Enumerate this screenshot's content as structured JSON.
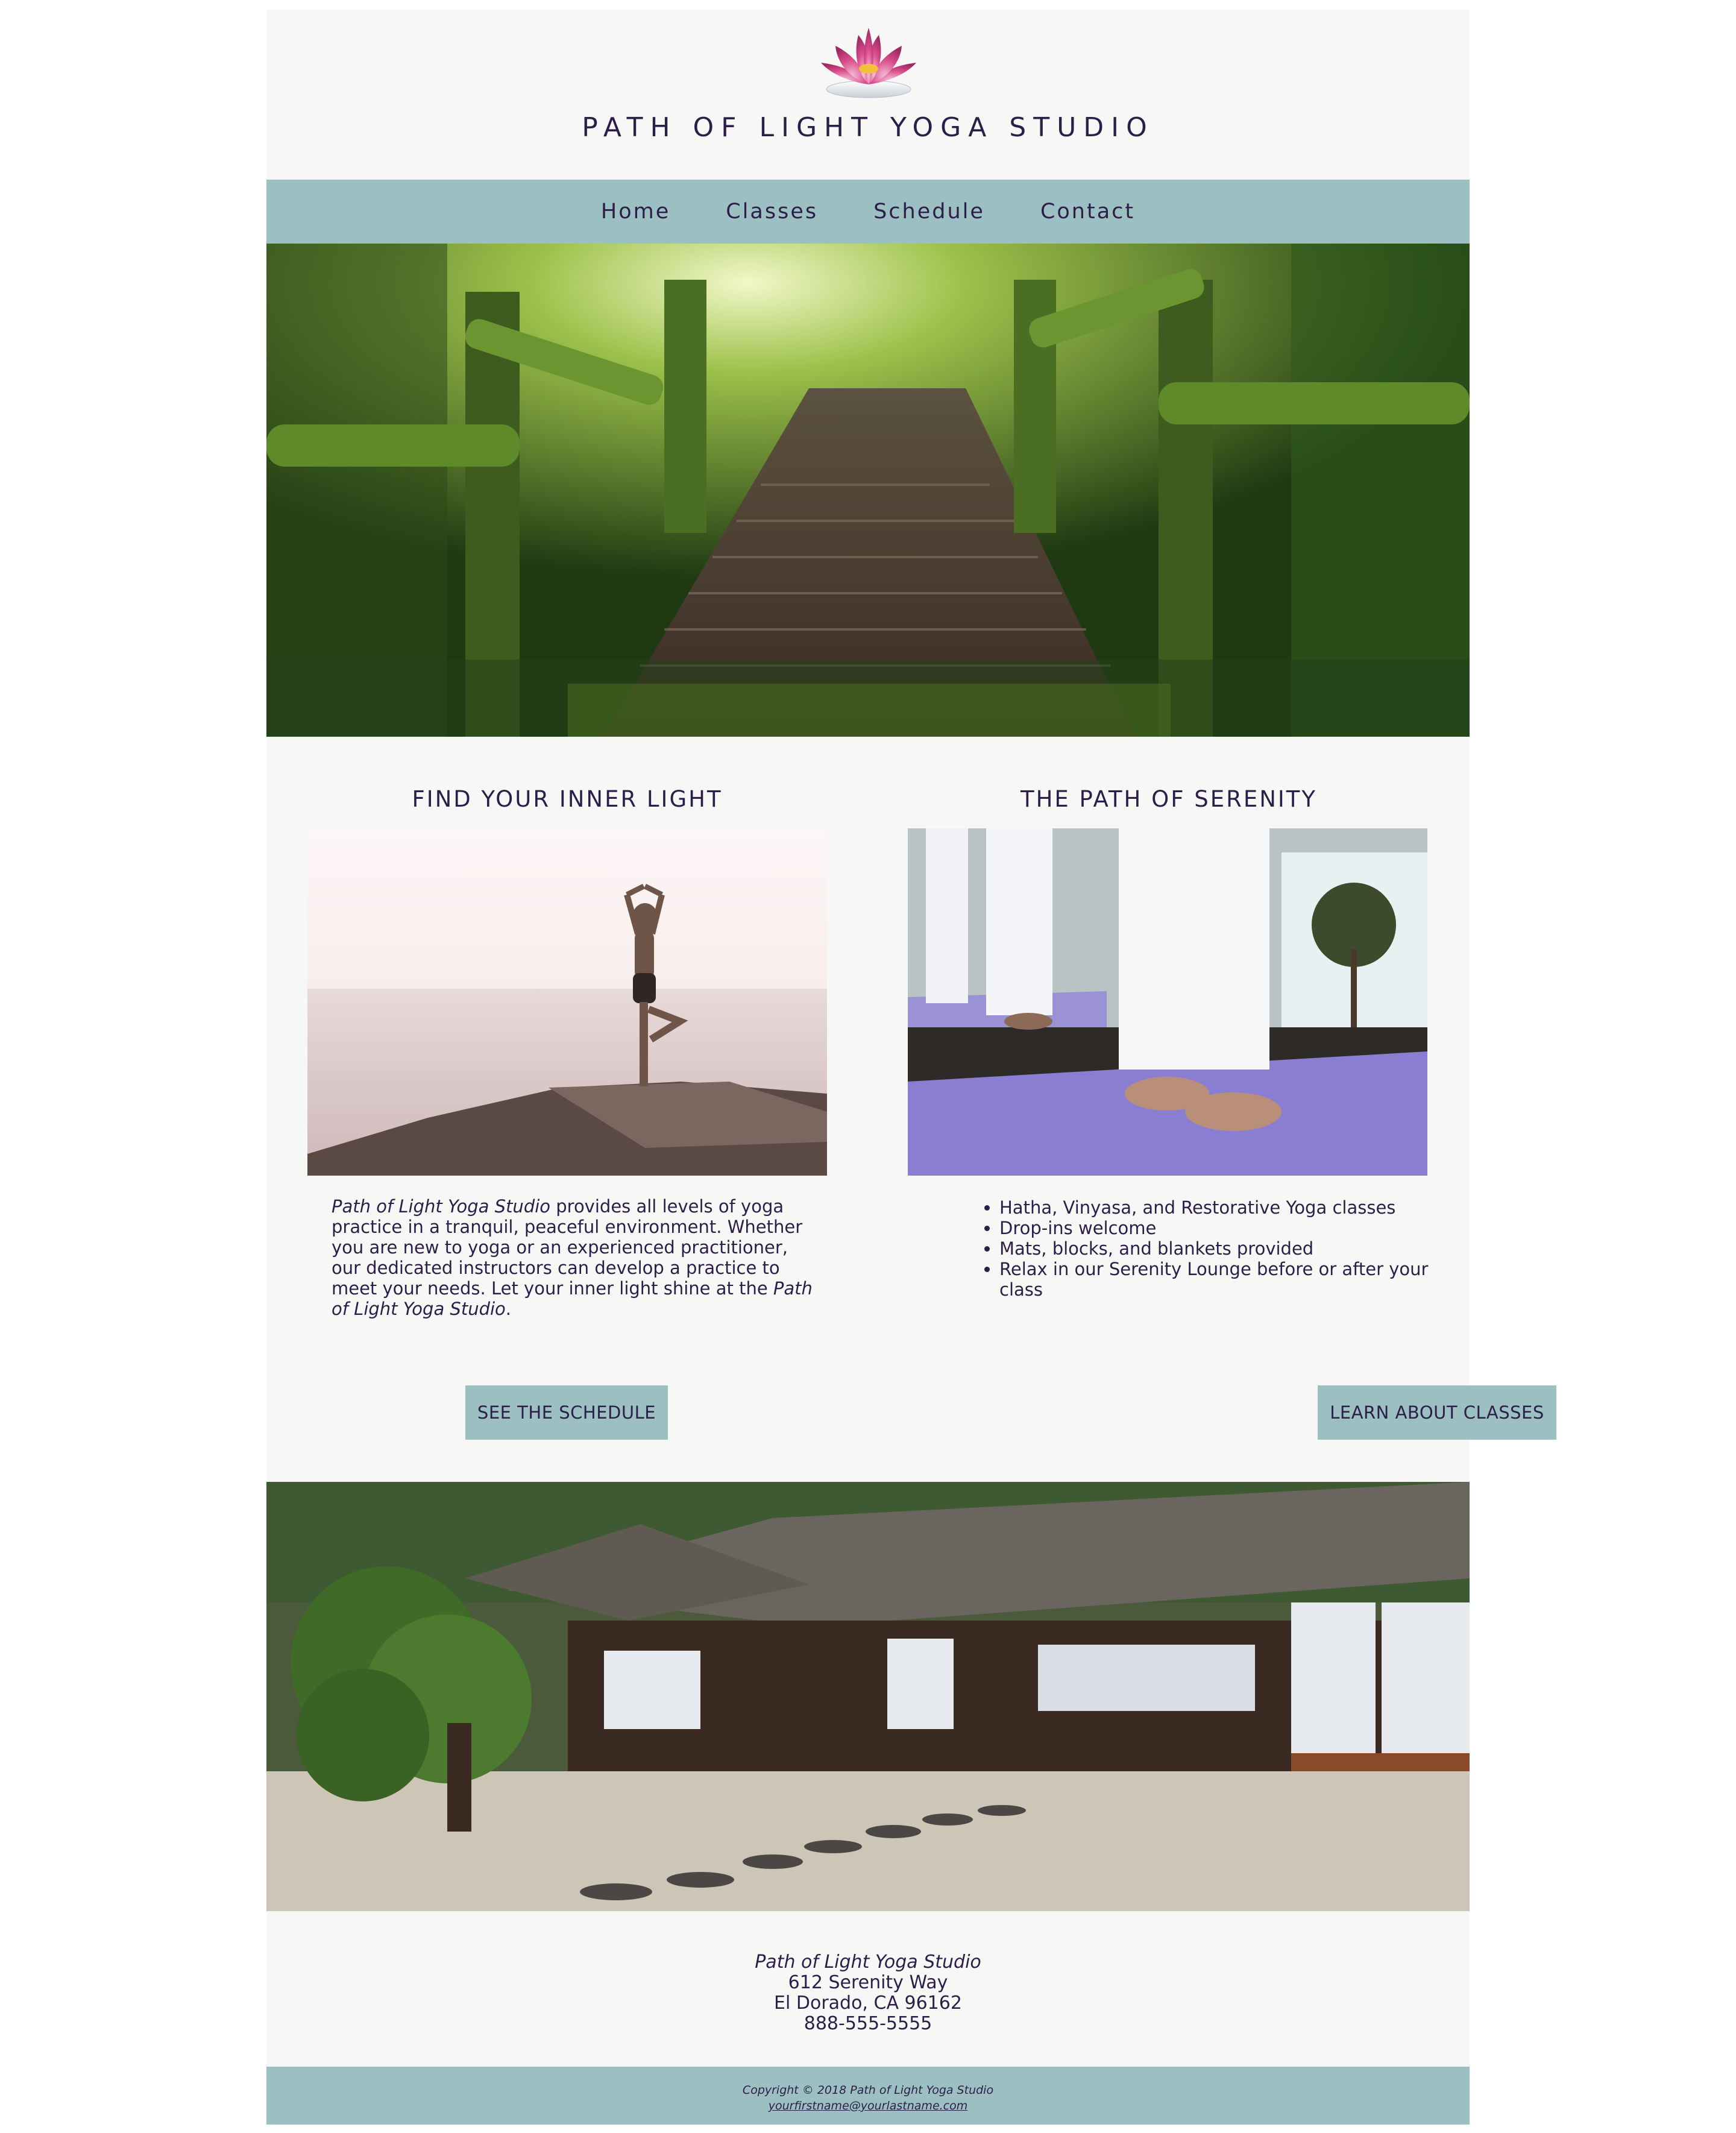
{
  "site": {
    "title": "PATH OF LIGHT YOGA STUDIO",
    "logo_icon": "lotus-flower-icon"
  },
  "nav": {
    "items": [
      "Home",
      "Classes",
      "Schedule",
      "Contact"
    ]
  },
  "colors": {
    "page_background": "#f7f7f5",
    "accent": "#9cc0c1",
    "text": "#2b1f4a"
  },
  "left_column": {
    "heading": "FIND YOUR INNER LIGHT",
    "paragraph_em_start": "Path of Light Yoga Studio",
    "paragraph_body": " provides all levels of yoga practice in a tranquil, peaceful environment. Whether you are new to yoga or an experienced practitioner, our dedicated instructors can develop a practice to meet your needs. Let your inner light shine at the ",
    "paragraph_em_end": "Path of Light Yoga Studio",
    "paragraph_end": ".",
    "button_label": "SEE THE SCHEDULE"
  },
  "right_column": {
    "heading": "THE PATH OF SERENITY",
    "list": [
      "Hatha, Vinyasa, and Restorative Yoga classes",
      "Drop-ins welcome",
      "Mats, blocks, and blankets provided",
      "Relax in our Serenity Lounge before or after your class"
    ],
    "button_label": "LEARN ABOUT CLASSES"
  },
  "address": {
    "name": "Path of Light Yoga Studio",
    "street": "612 Serenity Way",
    "city": "El Dorado, CA 96162",
    "phone": "888-555-5555"
  },
  "footer": {
    "copyright": "Copyright © 2018 Path of Light Yoga Studio",
    "email": "yourfirstname@yourlastname.com"
  }
}
